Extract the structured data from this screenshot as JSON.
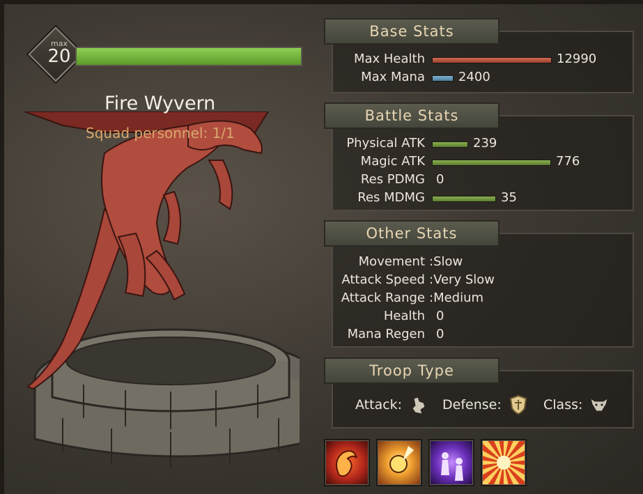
{
  "unit": {
    "level_label": "max",
    "level": "20",
    "health_bar_fraction": 1.0,
    "name": "Fire Wyvern",
    "squad": "Squad personnel: 1/1"
  },
  "base_stats": {
    "title": "Base Stats",
    "rows": [
      {
        "label": "Max Health",
        "value": "12990",
        "bar_color": "#c0553e"
      },
      {
        "label": "Max Mana",
        "value": "2400",
        "bar_color": "#6aa0c0"
      }
    ]
  },
  "battle_stats": {
    "title": "Battle Stats",
    "rows": [
      {
        "label": "Physical ATK",
        "value": "239"
      },
      {
        "label": "Magic ATK",
        "value": "776"
      },
      {
        "label": "Res PDMG",
        "value": "0"
      },
      {
        "label": "Res MDMG",
        "value": "35"
      }
    ]
  },
  "other_stats": {
    "title": "Other Stats",
    "rows": [
      {
        "label": "Movement",
        "value": ":Slow"
      },
      {
        "label": "Attack Speed",
        "value": ":Very Slow"
      },
      {
        "label": "Attack Range",
        "value": ":Medium"
      },
      {
        "label": "Health",
        "value": "0"
      },
      {
        "label": "Mana Regen",
        "value": "0"
      }
    ]
  },
  "troop_type": {
    "title": "Troop Type",
    "attack_label": "Attack:",
    "attack_icon": "ranged-attack-icon",
    "defense_label": "Defense:",
    "defense_icon": "shield-icon",
    "class_label": "Class:",
    "class_icon": "beast-head-icon"
  },
  "skills": [
    {
      "icon": "fire-dragon-skill-icon"
    },
    {
      "icon": "explosion-skill-icon"
    },
    {
      "icon": "purple-aura-skill-icon"
    },
    {
      "icon": "sunburst-skill-icon"
    }
  ],
  "colors": {
    "health_bar": "#6fb03a",
    "stat_bar_green": "#7da346",
    "tab_text": "#e7d6b4",
    "squad_text": "#d9a86e"
  }
}
